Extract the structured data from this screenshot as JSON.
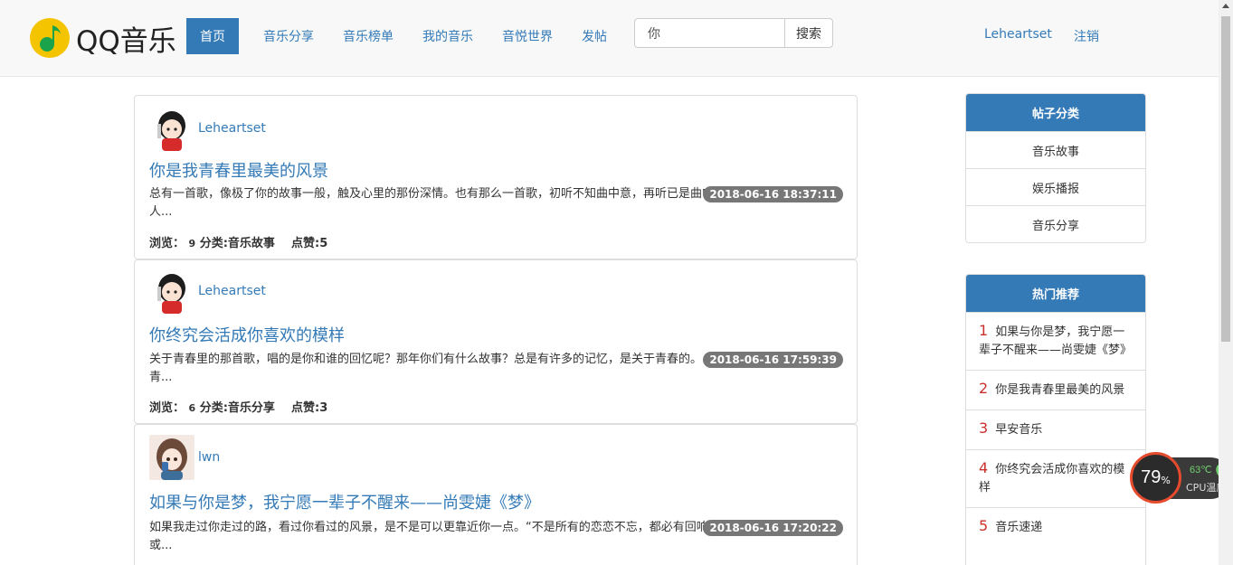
{
  "navbar": {
    "logo_text": "QQ音乐",
    "active": "首页",
    "items": [
      "音乐分享",
      "音乐榜单",
      "我的音乐",
      "音悦世界",
      "发帖"
    ],
    "search_value": "你",
    "search_button": "搜索",
    "username": "Leheartset",
    "logout": "注销"
  },
  "posts": [
    {
      "author": "Leheartset",
      "title": "你是我青春里最美的风景",
      "summary": "总有一首歌，像极了你的故事一般，触及心里的那份深情。也有那么一首歌，初听不知曲中意，再听已是曲中人...",
      "date": "2018-06-16 18:37:11",
      "views_label": "浏览：",
      "views": "9",
      "category": "分类:音乐故事",
      "likes": "点赞:5"
    },
    {
      "author": "Leheartset",
      "title": "你终究会活成你喜欢的模样",
      "summary": "关于青春里的那首歌，唱的是你和谁的回忆呢？那年你们有什么故事？总是有许多的记忆，是关于青春的。青...",
      "date": "2018-06-16 17:59:39",
      "views_label": "浏览：",
      "views": "6",
      "category": "分类:音乐分享",
      "likes": "点赞:3"
    },
    {
      "author": "lwn",
      "title": "如果与你是梦，我宁愿一辈子不醒来——尚雯婕《梦》",
      "summary": "如果我走过你走过的路，看过你看过的风景，是不是可以更靠近你一点。“不是所有的恋恋不忘，都必有回响。或...",
      "date": "2018-06-16 17:20:22"
    }
  ],
  "sidebar": {
    "categories_title": "帖子分类",
    "categories": [
      "音乐故事",
      "娱乐播报",
      "音乐分享"
    ],
    "hot_title": "热门推荐",
    "hot": [
      {
        "num": "1",
        "text": "如果与你是梦，我宁愿一辈子不醒来——尚雯婕《梦》"
      },
      {
        "num": "2",
        "text": "你是我青春里最美的风景"
      },
      {
        "num": "3",
        "text": "早安音乐"
      },
      {
        "num": "4",
        "text": "你终究会活成你喜欢的模样"
      },
      {
        "num": "5",
        "text": "音乐速递"
      }
    ]
  },
  "cpu_widget": {
    "percent": "79",
    "percent_sign": "%",
    "temp": "63℃",
    "label": "CPU温度"
  },
  "colors": {
    "accent": "#337ab7",
    "badge": "#777777",
    "hot_number": "#c9302c"
  }
}
